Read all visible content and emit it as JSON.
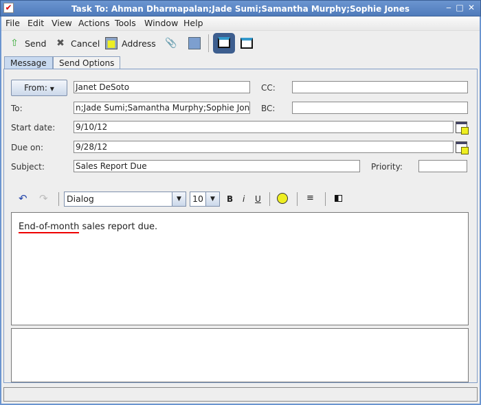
{
  "window": {
    "title": "Task To: Ahman Dharmapalan;Jade Sumi;Samantha Murphy;Sophie Jones"
  },
  "menu": [
    "File",
    "Edit",
    "View",
    "Actions",
    "Tools",
    "Window",
    "Help"
  ],
  "toolbar": {
    "send": "Send",
    "cancel": "Cancel",
    "address": "Address"
  },
  "tabs": [
    "Message",
    "Send Options"
  ],
  "form": {
    "from_label": "From:",
    "from_value": "Janet DeSoto",
    "cc_label": "CC:",
    "cc_value": "",
    "to_label": "To:",
    "to_value": "n;Jade Sumi;Samantha Murphy;Sophie Jones",
    "bc_label": "BC:",
    "bc_value": "",
    "start_label": "Start date:",
    "start_value": "9/10/12",
    "due_label": "Due on:",
    "due_value": "9/28/12",
    "subject_label": "Subject:",
    "subject_value": "Sales Report Due",
    "priority_label": "Priority:",
    "priority_value": ""
  },
  "format": {
    "font": "Dialog",
    "size": "10",
    "bold": "B",
    "italic": "i",
    "underline": "U"
  },
  "body": {
    "misspelled": "End-of-month",
    "rest": " sales report due."
  },
  "colors": {
    "titlebar": "#5b86c4",
    "spell_underline": "#e00000"
  }
}
